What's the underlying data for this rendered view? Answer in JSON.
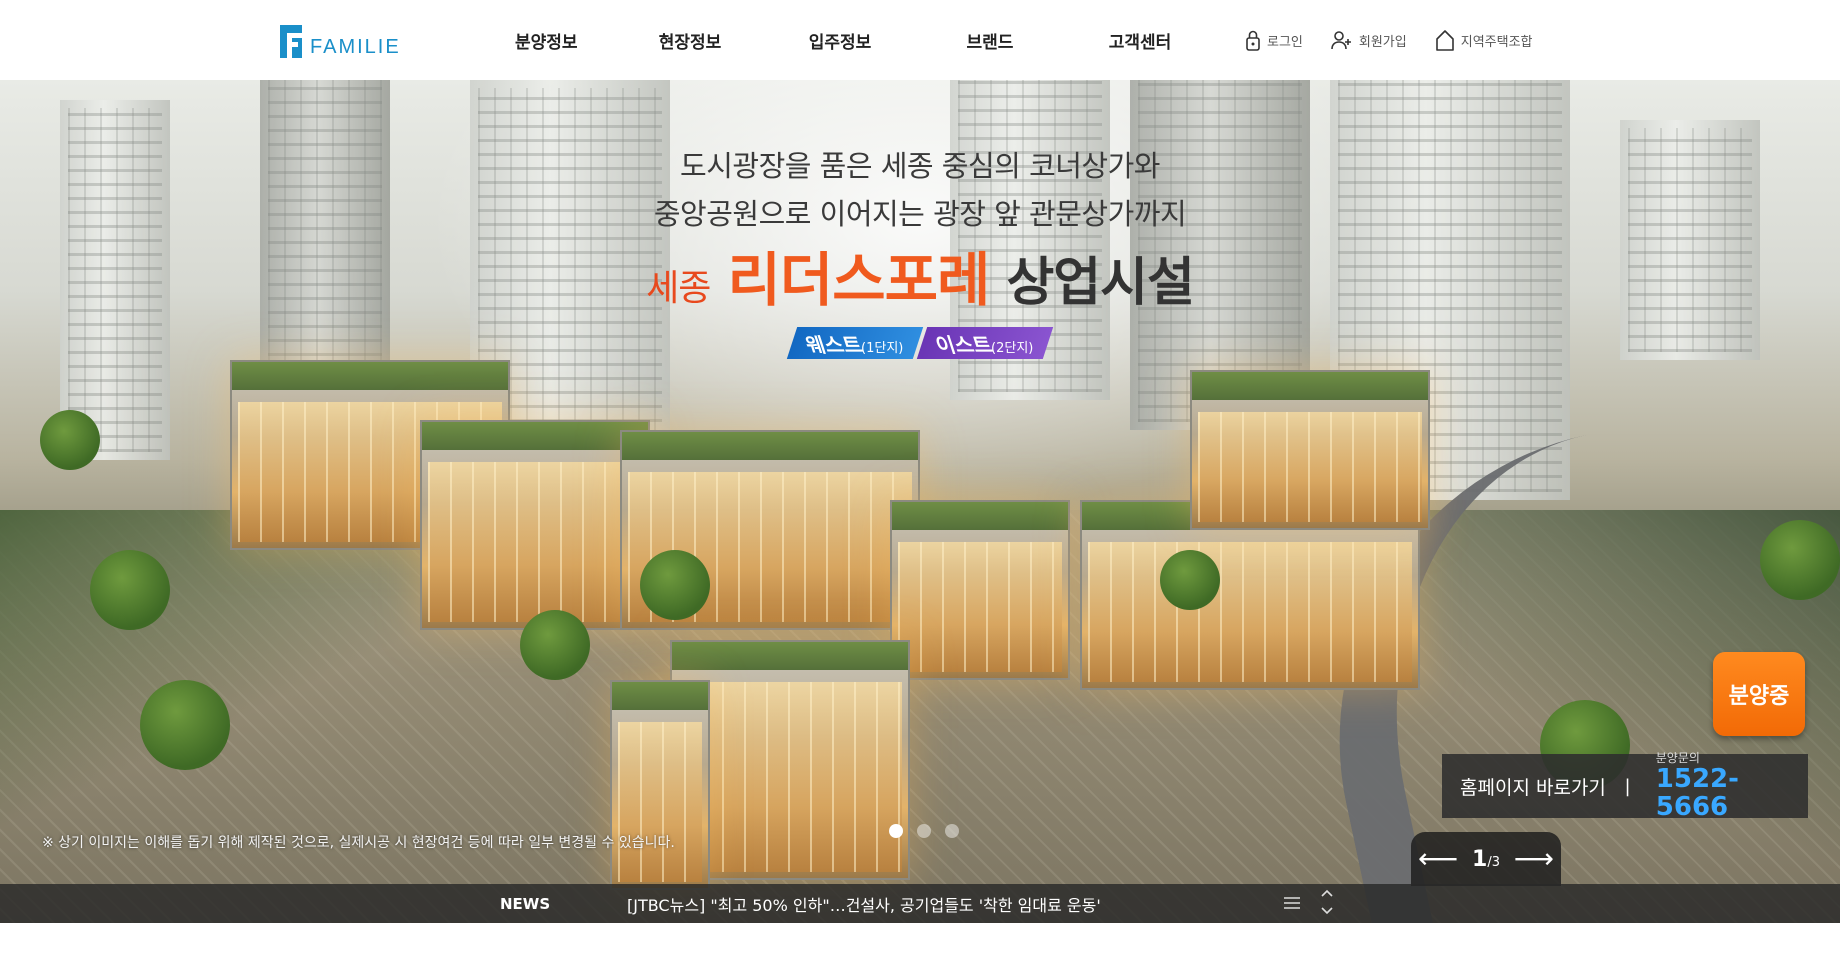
{
  "brand": {
    "logo_text": "FAMILIE",
    "logo_color": "#1a8fc9"
  },
  "nav": {
    "items": [
      {
        "label": "분양정보"
      },
      {
        "label": "현장정보"
      },
      {
        "label": "입주정보"
      },
      {
        "label": "브랜드"
      },
      {
        "label": "고객센터"
      }
    ]
  },
  "util": {
    "login": {
      "label": "로그인",
      "icon": "lock-icon"
    },
    "signup": {
      "label": "회원가입",
      "icon": "user-plus-icon"
    },
    "housing": {
      "label": "지역주택조합",
      "icon": "house-icon"
    }
  },
  "hero": {
    "copy_line1": "도시광장을 품은 세종 중심의 코너상가와",
    "copy_line2": "중앙공원으로 이어지는 광장 앞 관문상가까지",
    "title_a": "세종",
    "title_b": "리더스포레",
    "title_c": "상업시설",
    "badge_west": "웨스트",
    "badge_west_sub": "(1단지)",
    "badge_east": "이스트",
    "badge_east_sub": "(2단지)",
    "disclaimer": "※ 상기 이미지는 이해를 돕기 위해 제작된 것으로, 실제시공 시 현장여건 등에 따라 일부 변경될 수 있습니다.",
    "accent_orange": "#f05a1e",
    "badge_west_color": "#1268c2",
    "badge_east_color": "#6a35b5"
  },
  "slider": {
    "current": "1",
    "total": "/3",
    "prev_icon": "arrow-left-icon",
    "next_icon": "arrow-right-icon",
    "active_index": 0,
    "dot_count": 3
  },
  "sale_button": {
    "label": "분양중",
    "color": "#f26a06"
  },
  "contact": {
    "homepage_label": "홈페이지 바로가기",
    "separator": "|",
    "phone_label": "분양문의",
    "phone": "1522-5666",
    "phone_color": "#39a8ff"
  },
  "news": {
    "label": "NEWS",
    "headline": "[JTBC뉴스] \"최고 50% 인하\"…건설사, 공기업들도 '착한 임대료 운동'",
    "list_icon": "menu-icon",
    "up_icon": "chevron-up-icon",
    "down_icon": "chevron-down-icon"
  }
}
